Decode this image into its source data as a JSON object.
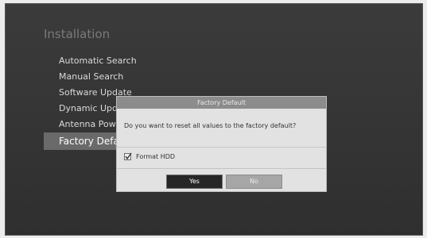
{
  "screen": {
    "title": "Installation"
  },
  "menu": {
    "items": [
      {
        "label": "Automatic Search"
      },
      {
        "label": "Manual Search"
      },
      {
        "label": "Software Update"
      },
      {
        "label": "Dynamic Update"
      },
      {
        "label": "Antenna Power"
      },
      {
        "label": "Factory Default"
      }
    ],
    "selected_index": 5
  },
  "dialog": {
    "title": "Factory Default",
    "message": "Do you want to reset all values to the factory default?",
    "checkbox": {
      "label": "Format HDD",
      "checked": true
    },
    "yes_label": "Yes",
    "no_label": "No",
    "focused_button": "Yes"
  }
}
